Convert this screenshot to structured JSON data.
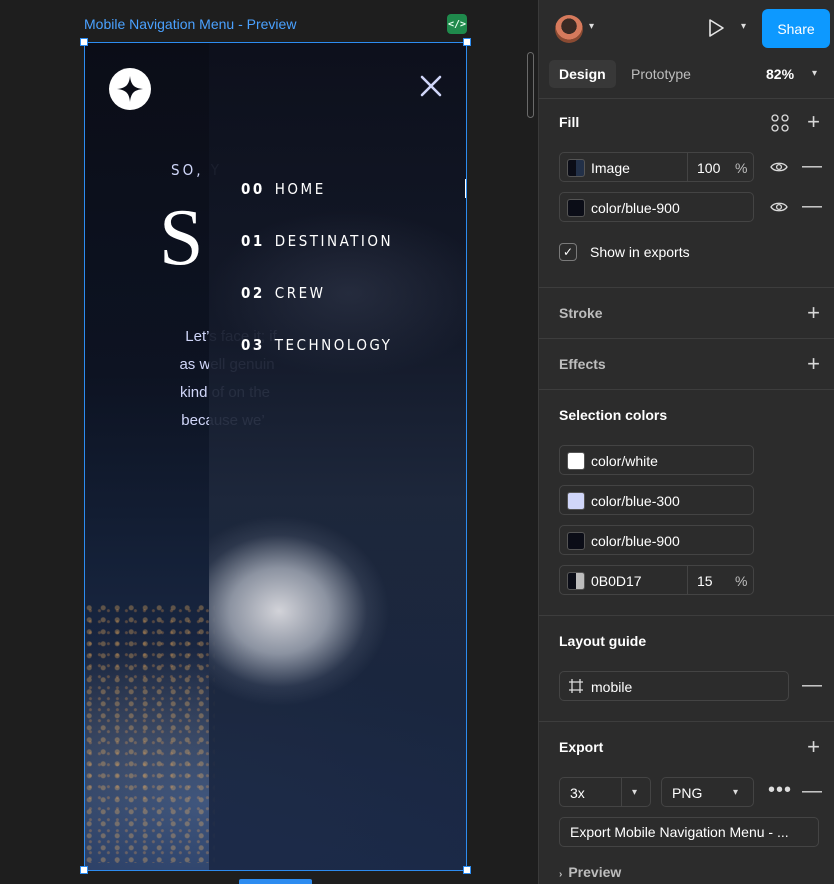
{
  "canvas": {
    "frame_label": "Mobile Navigation Menu - Preview",
    "code_badge": "</>"
  },
  "preview": {
    "hero_subtitle": "SO, Y",
    "hero_title": "S",
    "hero_body_lines": [
      "Let’s face it; if",
      "as well genuin",
      "kind of on the",
      "because we’"
    ],
    "nav_items": [
      {
        "num": "00",
        "label": "HOME"
      },
      {
        "num": "01",
        "label": "DESTINATION"
      },
      {
        "num": "02",
        "label": "CREW"
      },
      {
        "num": "03",
        "label": "TECHNOLOGY"
      }
    ]
  },
  "panel": {
    "share_label": "Share",
    "tabs": [
      {
        "label": "Design",
        "active": true
      },
      {
        "label": "Prototype",
        "active": false
      }
    ],
    "zoom": "82%",
    "fill": {
      "title": "Fill",
      "rows": [
        {
          "label": "Image",
          "opacity": "100",
          "unit": "%"
        },
        {
          "label": "color/blue-900"
        }
      ],
      "show_in_exports": "Show in exports"
    },
    "stroke_title": "Stroke",
    "effects_title": "Effects",
    "selection_colors": {
      "title": "Selection colors",
      "items": [
        {
          "label": "color/white",
          "color": "#FFFFFF"
        },
        {
          "label": "color/blue-300",
          "color": "#D0D6F9"
        },
        {
          "label": "color/blue-900",
          "color": "#0B0D17"
        },
        {
          "label": "0B0D17",
          "opacity": "15",
          "unit": "%",
          "color": "#0B0D17"
        }
      ]
    },
    "layout_guide": {
      "title": "Layout guide",
      "value": "mobile"
    },
    "export": {
      "title": "Export",
      "scale": "3x",
      "format": "PNG",
      "button_label": "Export Mobile Navigation Menu - ...",
      "preview_label": "Preview"
    }
  },
  "colors": {
    "accent": "#0D99FF",
    "selection": "#2D8CF0",
    "panel_bg": "#2C2C2C",
    "canvas_bg": "#1E1E1E"
  }
}
